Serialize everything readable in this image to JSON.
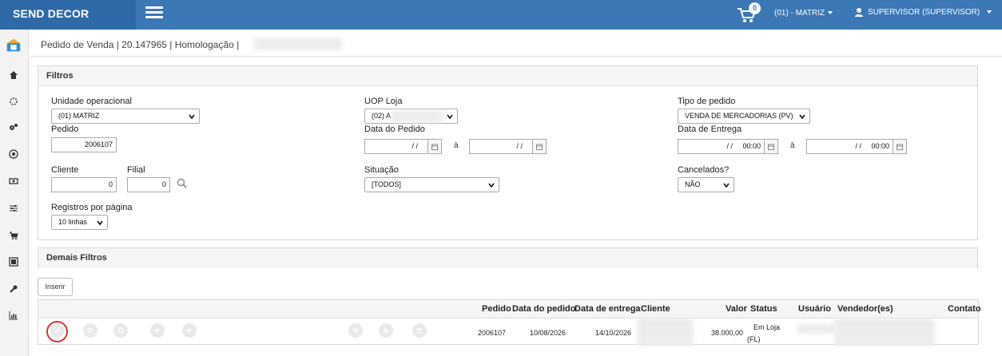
{
  "app": {
    "brand": "SEND DECOR"
  },
  "topbar": {
    "cart_count": "0",
    "branch": "(01) - MATRIZ",
    "user": "SUPERVISOR (SUPERVISOR)"
  },
  "breadcrumb": "Pedido de Venda | 20.147965 | Homologação |",
  "filters": {
    "title": "Filtros",
    "unidade_label": "Unidade operacional",
    "unidade_value": "(01) MATRIZ",
    "uop_label": "UOP Loja",
    "uop_value": "(02) A",
    "tipo_label": "Tipo de pedido",
    "tipo_value": "VENDA DE MERCADORIAS (PV)",
    "pedido_label": "Pedido",
    "pedido_value": "2006107",
    "data_pedido_label": "Data do Pedido",
    "data_pedido_from": "/ /",
    "data_pedido_to": "/ /",
    "data_entrega_label": "Data de Entrega",
    "data_entrega_from": "/ /     00:00",
    "data_entrega_to": "/ /     00:00",
    "range_sep": "à",
    "cliente_label": "Cliente",
    "cliente_value": "0",
    "filial_label": "Filial",
    "filial_value": "0",
    "situacao_label": "Situação",
    "situacao_value": "[TODOS]",
    "cancelados_label": "Cancelados?",
    "cancelados_value": "NÃO",
    "registros_label": "Registros por página",
    "registros_value": "10 linhas"
  },
  "demais": {
    "title": "Demais Filtros"
  },
  "actions": {
    "inserir": "Inserir"
  },
  "table": {
    "headers": [
      "Pedido",
      "Data do pedido",
      "Data de entrega",
      "Cliente",
      "Valor",
      "Status",
      "Usuário",
      "Vendedor(es)",
      "Contato"
    ],
    "rows": [
      {
        "pedido": "2006107",
        "data_pedido": "10/08/2026",
        "data_entrega": "14/10/2026",
        "valor": "38.000,00",
        "status_1": "Em Loja",
        "status_2": "(FL)"
      }
    ]
  },
  "colors": {
    "topbar": "#3c77b6",
    "brand_bg": "#2f6aa8",
    "highlight": "#e03030"
  }
}
